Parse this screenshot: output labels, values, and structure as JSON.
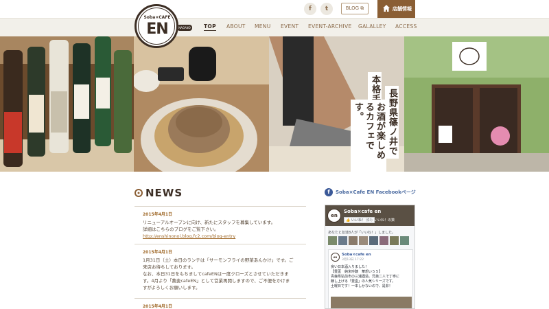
{
  "header": {
    "social": [
      "f",
      "t"
    ],
    "blog_label": "BLOG ⧉",
    "store_label": "店舗情報",
    "logo": {
      "top_text": "Soba×CAFE",
      "main_text": "EN",
      "tag_text": "NAGANO"
    },
    "nav": [
      {
        "label": "TOP",
        "active": true
      },
      {
        "label": "ABOUT"
      },
      {
        "label": "MENU"
      },
      {
        "label": "EVENT"
      },
      {
        "label": "EVENT-ARCHIVE"
      },
      {
        "label": "GALALLEY"
      },
      {
        "label": "ACCESS"
      }
    ]
  },
  "hero": {
    "lines": [
      "長野県篠ノ井で",
      "本格手打ち蕎麦と",
      "お酒が楽しめるカフェです。"
    ]
  },
  "news": {
    "title": "NEWS",
    "items": [
      {
        "date": "2015年4月1日",
        "body": [
          "リニューアルオープンに向け、新たにスタッフを募集しています。",
          "詳細はこちらのブログをご覧下さい。"
        ],
        "link": "http://enshinonoi.blog.fc2.com/blog-entry"
      },
      {
        "date": "2015年4月1日",
        "body": [
          "1月31日（土）本日のランチは「サーモンフライの野菜あんかけ」です。ご",
          "来店お待ちしております。",
          "なお、本日31日をもちましてcafeENは一度クローズとさせていただきま",
          "す。4月より「蕎麦cafeEN」として営業再開しますので、ご不便をかけま",
          "すがよろしくお願いします。"
        ]
      },
      {
        "date": "2015年4月1日",
        "body": []
      }
    ]
  },
  "facebook": {
    "heading": "Soba×Cafe EN Facebookページ",
    "page_name": "Soba×cafe en",
    "avatar_text": "en",
    "like_label": "👍 いいね！ 済み",
    "like_count": "201 いいね！の数",
    "friends_text": "あなたと友達8人が「いいね！」しました。",
    "post": {
      "author": "Soba×cafe en",
      "date": "3月13日 17:22",
      "text": [
        "良い日本酒入りました！",
        "【豊盃　純米吟醸　華想い５５】",
        "青森県弘前市の三浦酒造。兄弟二人で丁寧に",
        "醸し上げる「豊盃」の人気シリーズです。",
        "土曜日です！一本しかないので、是非！"
      ]
    }
  }
}
